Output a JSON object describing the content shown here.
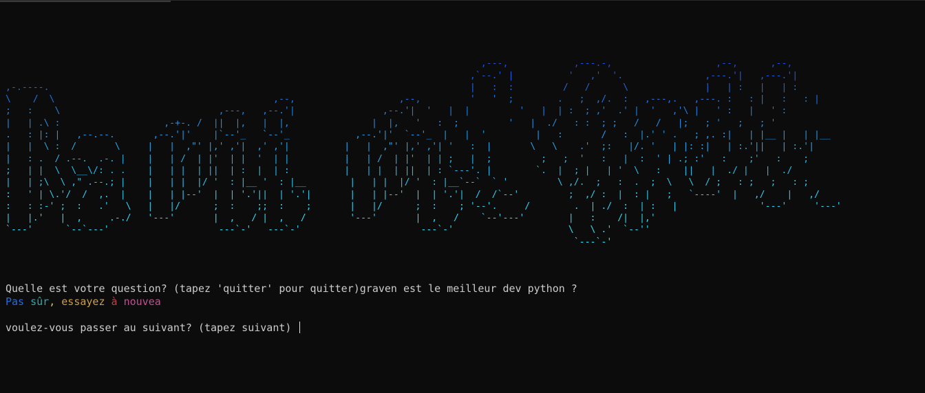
{
  "terminal": {
    "banner_lines": [
      "                                                                                                                                           ",
      "                                                                                       ,---,            ,---.-,                   ,--,      ,--, ",
      "                                                                                     ,`--.' |          '   ,'  '.               ,---.'|   ,---.'| ",
      ",-.----.                                                                             |   :  :         /   /      \\              |   | :   |   | : ",
      "\\    /  \\                                        ,--,                   ,--,         '   '  ;        .   ;  ,/.  :   ,---,.   ,---. :   : |   :   : | ",
      ";   :    \\                             ,---,   ,--.'|                ,--.'|  '   |  |         '   |  | :  ; ,'  .' |  '   ,'\\ |   ' :   |   ' : ",
      "|   | .\\ :                   ,-+-. /  ||  |,   |  |,               |  |,   '   :  ;         '   |  ./   : :  ; ;   /   /   |;   ; '   ;   ; ' ",
      ".   : |: |   ,--.--.       ,--.'|'    |`--'_   `--'_            ,--.'|'  `--'_  |   |  '         |   :       /   :  |.' ' .   ; ,. :|   | |__ |   | |__ ",
      "|   |  \\ :  /       \\     |   |  ,\"' |,' ,'|  ,' ,'|          |   |  ,\"' |,' ,'| '   :  |       \\   \\    .'  ;:   |/. '   | |: :|   | :.'||   | :.'| ",
      "|   : .  / .--.  .-. |    |   | /  | |'  | |  '  | |          |   | /  | |'  | | ;   |  ;         ;   ;  '   :   |  :  ' | .; :'   :    ;'   :    ; ",
      ";   | |  \\  \\__\\/: . .    |   | |  | ||  | :  |  | :          |   | |  | ||  | : `---'. |        `.  |  ; |   | '  \\   :    ||   |  ./ |   |  ./ ",
      "|   | ;\\  \\ ,\" .--.; |    |   | |  |/ '  : |__ '  : |__        |   | |  |/ '  : |__`--`  ` '         \\ ,/.  ;   :  .  ;  \\   \\  / ;   : ;   ;   : ;  ",
      ":   ' | \\.'/  /  ,.  |    |   | |--'  |  | '.'||  | '.'|       |   | |--'  |  | '.'|  /  /`--'         ;  ,/ :  |  : |   ;   `----'  |   ,/    |   ,/   ",
      ":   : :-' ;  :   .'   \\   |   |/      ;  :    ;;  :    ;       |   |/      ;  :    ; '--'.     /        .  | ./  :  | :   |               '---'     '---'    ",
      "|   |.'   |  ,     .-./   '---'       |  ,   / |  ,   /        '---'       |  ,   /    `--'---'        |   :    /|  |,'   ",
      "`---'      `--`---'                    ---`-'   ---`-'                      ---`-'                     \\   \\ .'  `--''    ",
      "                                                                                                        `---`-'            "
    ],
    "banner_colors": [
      "#1a4fd6",
      "#1a4fd6",
      "#1c5ad8",
      "#1e66da",
      "#1f72dc",
      "#217ede",
      "#238ae0",
      "#2596e2",
      "#27a2e4",
      "#29aee6",
      "#2bbae8",
      "#2dc2ea",
      "#2fcaec",
      "#31d0ee",
      "#33d6ef",
      "#35dcf0",
      "#37e0f1"
    ],
    "question_line": "Quelle est votre question? (tapez 'quitter' pour quitter)graven est le meilleur dev python ?",
    "answer_segments": [
      {
        "text": "Pas ",
        "color": "#2a6ad4"
      },
      {
        "text": "sûr",
        "color": "#3aa7a0"
      },
      {
        "text": ", ",
        "color": "#c8c850"
      },
      {
        "text": "essayez",
        "color": "#d0a040"
      },
      {
        "text": " à ",
        "color": "#c04050"
      },
      {
        "text": "nouvea",
        "color": "#c05090"
      }
    ],
    "answer_text": "Pas sûr, essayez à nouvea",
    "prompt_line": "voulez-vous passer au suivant? (tapez suivant) "
  }
}
